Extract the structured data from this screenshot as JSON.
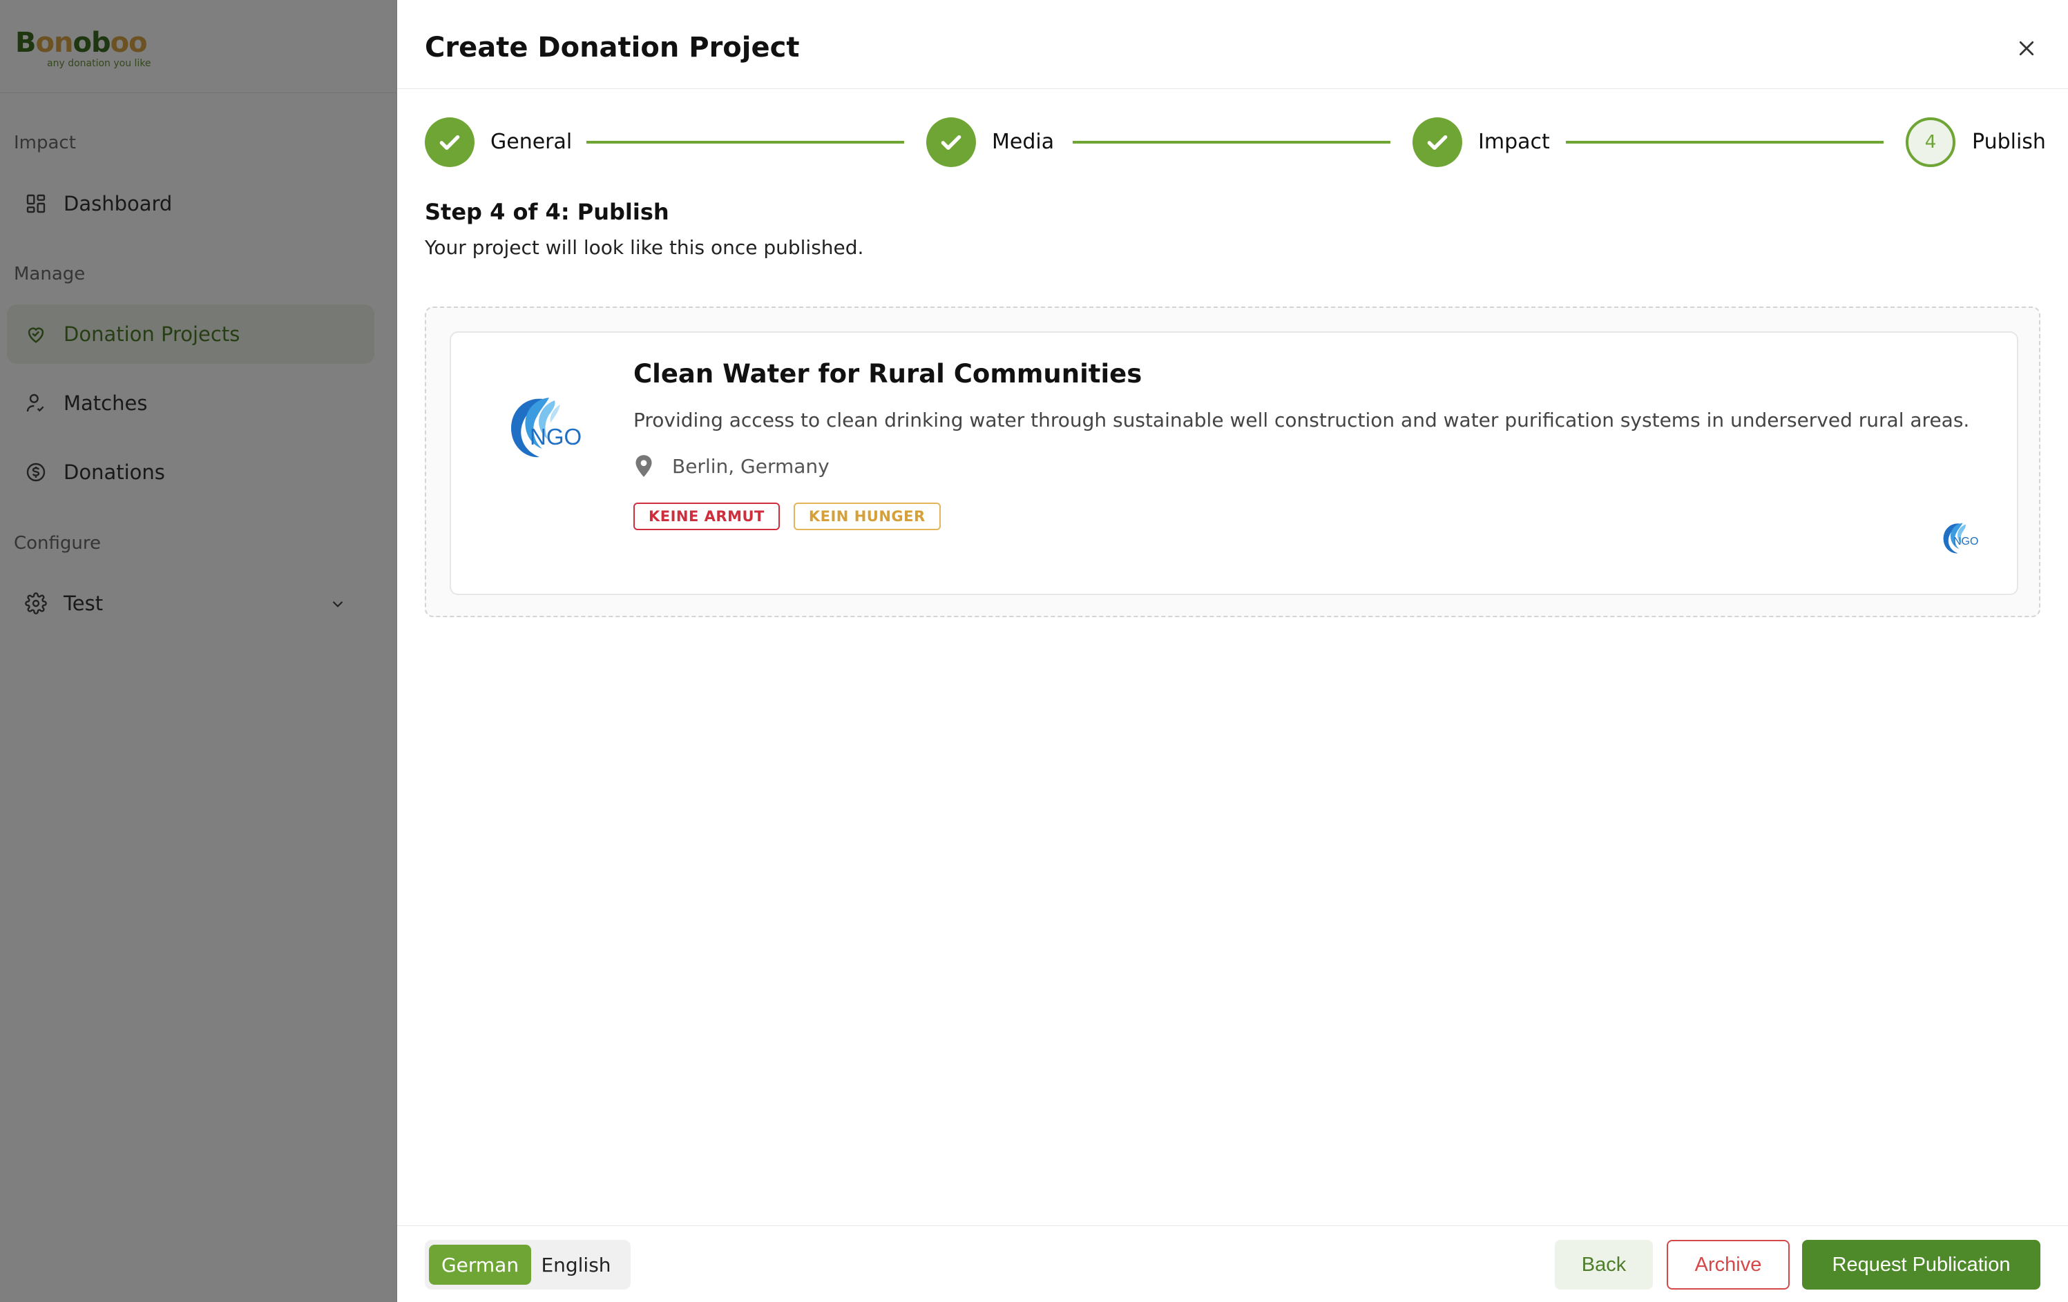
{
  "sidebar": {
    "logo_text": "Bonoboo",
    "logo_tagline": "any donation you like",
    "sections": {
      "impact": "Impact",
      "manage": "Manage",
      "configure": "Configure"
    },
    "items": {
      "dashboard": "Dashboard",
      "donation_projects": "Donation Projects",
      "matches": "Matches",
      "donations": "Donations",
      "test": "Test"
    }
  },
  "dialog": {
    "title": "Create Donation Project",
    "steps": [
      {
        "label": "General",
        "status": "done"
      },
      {
        "label": "Media",
        "status": "done"
      },
      {
        "label": "Impact",
        "status": "done"
      },
      {
        "label": "Publish",
        "status": "current",
        "number": "4"
      }
    ],
    "step_heading": "Step 4 of 4: Publish",
    "step_subtext": "Your project will look like this once published."
  },
  "preview": {
    "title": "Clean Water for Rural Communities",
    "description": "Providing access to clean drinking water through sustainable well construction and water purification systems in underserved rural areas.",
    "location": "Berlin, Germany",
    "tags": [
      "KEINE ARMUT",
      "KEIN HUNGER"
    ],
    "logo_text": "NGO"
  },
  "footer": {
    "languages": {
      "active": "German",
      "inactive": "English"
    },
    "back": "Back",
    "archive": "Archive",
    "request_publication": "Request Publication"
  },
  "colors": {
    "brand_green": "#6fa534",
    "dark_green": "#4e8a2a",
    "danger_red": "#d54848",
    "tag_red": "#cf2e3d",
    "tag_gold": "#d5a038"
  }
}
